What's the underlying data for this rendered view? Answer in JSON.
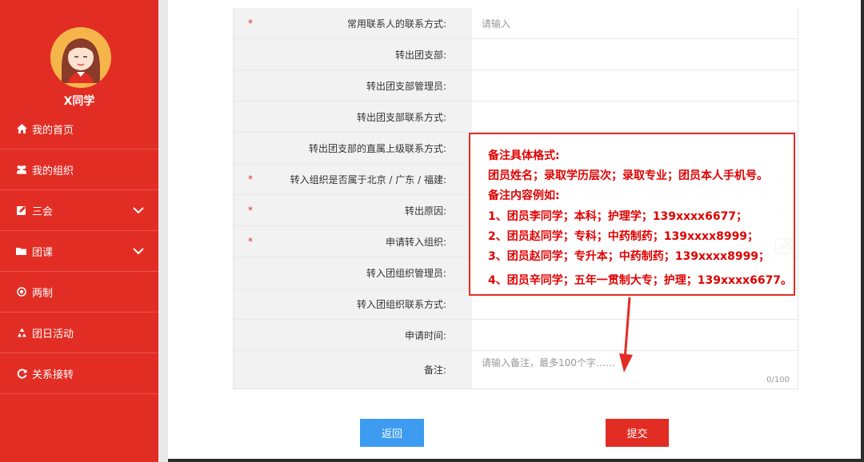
{
  "sidebar": {
    "username": "X同学",
    "items": [
      {
        "label": "我的首页",
        "icon": "home-icon"
      },
      {
        "label": "我的组织",
        "icon": "users-icon"
      },
      {
        "label": "三会",
        "icon": "edit-icon",
        "expandable": true
      },
      {
        "label": "团课",
        "icon": "folder-icon",
        "expandable": true
      },
      {
        "label": "两制",
        "icon": "circle-dot-icon"
      },
      {
        "label": "团日活动",
        "icon": "recycle-icon"
      },
      {
        "label": "关系接转",
        "icon": "refresh-icon"
      }
    ]
  },
  "form": {
    "rows": [
      {
        "label": "常用联系人的联系方式:",
        "required": true,
        "placeholder": "请输入"
      },
      {
        "label": "转出团支部:",
        "required": false,
        "placeholder": ""
      },
      {
        "label": "转出团支部管理员:",
        "required": false,
        "placeholder": ""
      },
      {
        "label": "转出团支部联系方式:",
        "required": false,
        "placeholder": ""
      },
      {
        "label": "转出团支部的直属上级联系方式:",
        "required": false,
        "placeholder": ""
      },
      {
        "label": "转入组织是否属于北京 / 广东 / 福建:",
        "required": true,
        "placeholder": ""
      },
      {
        "label": "转出原因:",
        "required": true,
        "placeholder": ""
      },
      {
        "label": "申请转入组织:",
        "required": true,
        "placeholder": ""
      },
      {
        "label": "转入团组织管理员:",
        "required": false,
        "placeholder": ""
      },
      {
        "label": "转入团组织联系方式:",
        "required": false,
        "placeholder": ""
      },
      {
        "label": "申请时间:",
        "required": false,
        "placeholder": ""
      },
      {
        "label": "备注:",
        "required": false,
        "placeholder": "请输入备注，最多100个字……",
        "counter": "0/100"
      }
    ],
    "required_mark": "*"
  },
  "note": {
    "lines": [
      "备注具体格式:",
      "团员姓名；录取学历层次；录取专业；团员本人手机号。",
      "备注内容例如:",
      "1、团员李同学；本科；护理学；139xxxx6677；",
      "2、团员赵同学；专科；中药制药；139xxxx8999；",
      "3、团员赵同学；专升本；中药制药；139xxxx8999；",
      "4、团员辛同学；五年一贯制大专；护理；139xxxx6677。"
    ]
  },
  "buttons": {
    "back_label": "返回",
    "submit_label": "提交"
  },
  "colors": {
    "brand_red": "#e22d24",
    "back_blue": "#3d9cf0"
  }
}
